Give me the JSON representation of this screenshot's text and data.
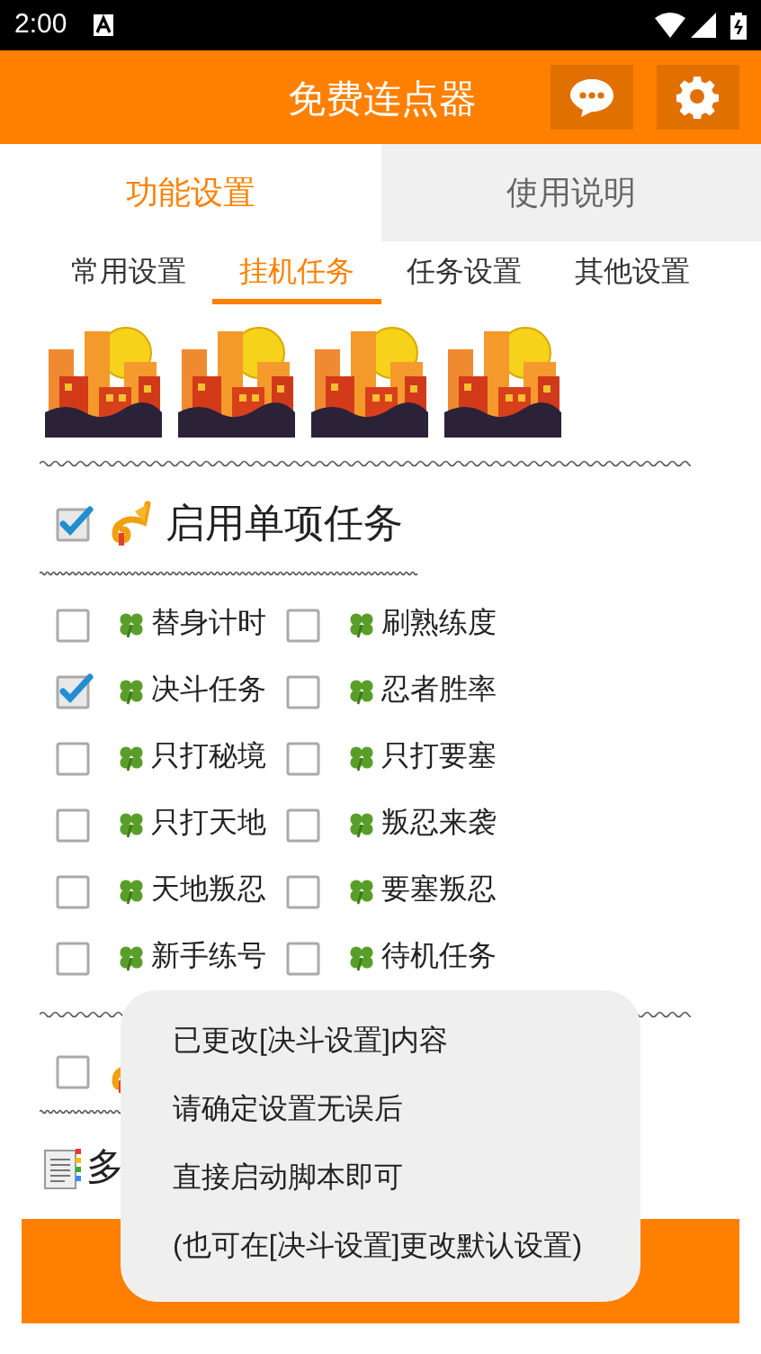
{
  "status_bar": {
    "time": "2:00"
  },
  "header": {
    "title": "免费连点器"
  },
  "main_tabs": [
    {
      "label": "功能设置",
      "selected": true
    },
    {
      "label": "使用说明",
      "selected": false
    }
  ],
  "sub_tabs": [
    {
      "label": "常用设置",
      "selected": false
    },
    {
      "label": "挂机任务",
      "selected": true
    },
    {
      "label": "任务设置",
      "selected": false
    },
    {
      "label": "其他设置",
      "selected": false
    }
  ],
  "single_task": {
    "label": "启用单项任务",
    "checked": true,
    "options": [
      {
        "label": "替身计时",
        "checked": false
      },
      {
        "label": "刷熟练度",
        "checked": false
      },
      {
        "label": "决斗任务",
        "checked": true
      },
      {
        "label": "忍者胜率",
        "checked": false
      },
      {
        "label": "只打秘境",
        "checked": false
      },
      {
        "label": "只打要塞",
        "checked": false
      },
      {
        "label": "只打天地",
        "checked": false
      },
      {
        "label": "叛忍来袭",
        "checked": false
      },
      {
        "label": "天地叛忍",
        "checked": false
      },
      {
        "label": "要塞叛忍",
        "checked": false
      },
      {
        "label": "新手练号",
        "checked": false
      },
      {
        "label": "待机任务",
        "checked": false
      }
    ]
  },
  "multi_task": {
    "checked": false
  },
  "order_heading": "多",
  "toast": {
    "lines": [
      "已更改[决斗设置]内容",
      "请确定设置无误后",
      "直接启动脚本即可",
      "(也可在[决斗设置]更改默认设置)"
    ]
  }
}
